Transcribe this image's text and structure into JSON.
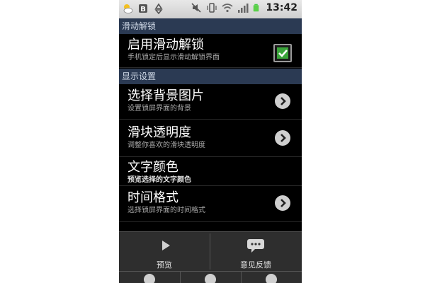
{
  "status_bar": {
    "time": "13:42",
    "icons_left": [
      "weather-icon",
      "b-icon",
      "recycle-icon"
    ],
    "icons_right": [
      "mute-icon",
      "vibrate-icon",
      "wifi-icon",
      "signal-icon",
      "battery-icon"
    ]
  },
  "sections": {
    "slide_unlock": "滑动解锁",
    "display": "显示设置"
  },
  "items": [
    {
      "title": "启用滑动解锁",
      "subtitle": "手机锁定后显示滑动解锁界面",
      "control": "checkbox",
      "checked": true
    },
    {
      "title": "选择背景图片",
      "subtitle": "设置锁屏界面的背景",
      "control": "arrow"
    },
    {
      "title": "滑块透明度",
      "subtitle": "调整你喜欢的滑块透明度",
      "control": "arrow"
    },
    {
      "title": "文字颜色",
      "subtitle": "预览选择的文字颜色",
      "control": "none"
    },
    {
      "title": "时间格式",
      "subtitle": "选择锁屏界面的时间格式",
      "control": "arrow"
    }
  ],
  "bottom_bar": {
    "preview_label": "预览",
    "feedback_label": "意见反馈"
  },
  "colors": {
    "section_bg": "#2b3a53",
    "check_green": "#3aa43a",
    "background": "#000000"
  }
}
